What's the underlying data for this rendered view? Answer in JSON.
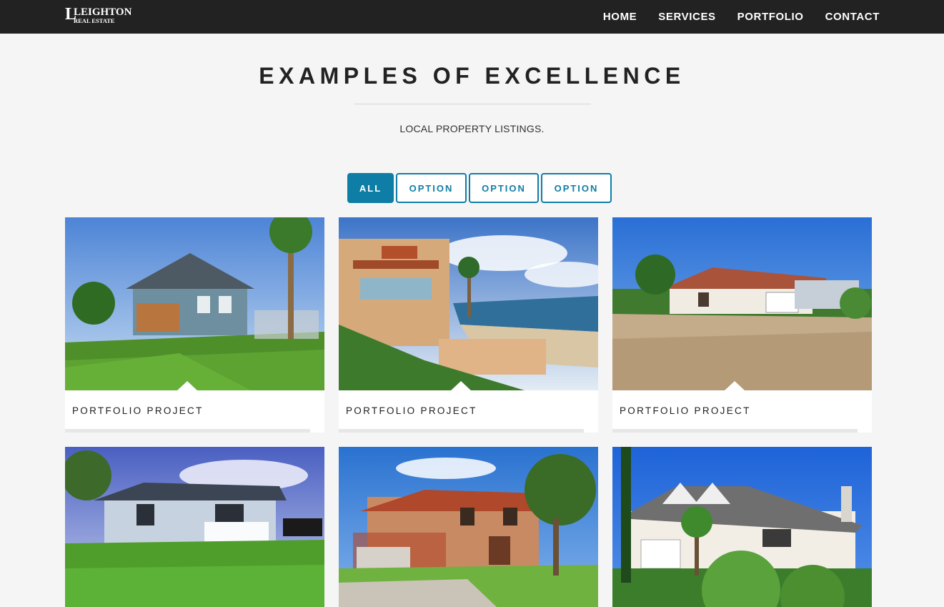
{
  "brand": {
    "logo_text_1": "LEIGHTON",
    "logo_text_2": "REAL ESTATE"
  },
  "nav": {
    "items": [
      {
        "label": "HOME"
      },
      {
        "label": "SERVICES"
      },
      {
        "label": "PORTFOLIO"
      },
      {
        "label": "CONTACT"
      }
    ]
  },
  "section": {
    "title": "EXAMPLES OF EXCELLENCE",
    "subtitle": "LOCAL PROPERTY LISTINGS."
  },
  "filters": [
    {
      "label": "ALL",
      "active": true
    },
    {
      "label": "OPTION",
      "active": false
    },
    {
      "label": "OPTION",
      "active": false
    },
    {
      "label": "OPTION",
      "active": false
    }
  ],
  "portfolio": [
    {
      "label": "PORTFOLIO PROJECT",
      "image": "house-photo"
    },
    {
      "label": "PORTFOLIO PROJECT",
      "image": "beach-house-photo"
    },
    {
      "label": "PORTFOLIO PROJECT",
      "image": "ranch-house-photo"
    },
    {
      "label": "",
      "image": "cottage-photo"
    },
    {
      "label": "",
      "image": "two-story-house-photo"
    },
    {
      "label": "",
      "image": "suburban-house-photo"
    }
  ],
  "colors": {
    "accent": "#0f7ea6",
    "navbar": "#222222",
    "background": "#f5f5f5"
  }
}
